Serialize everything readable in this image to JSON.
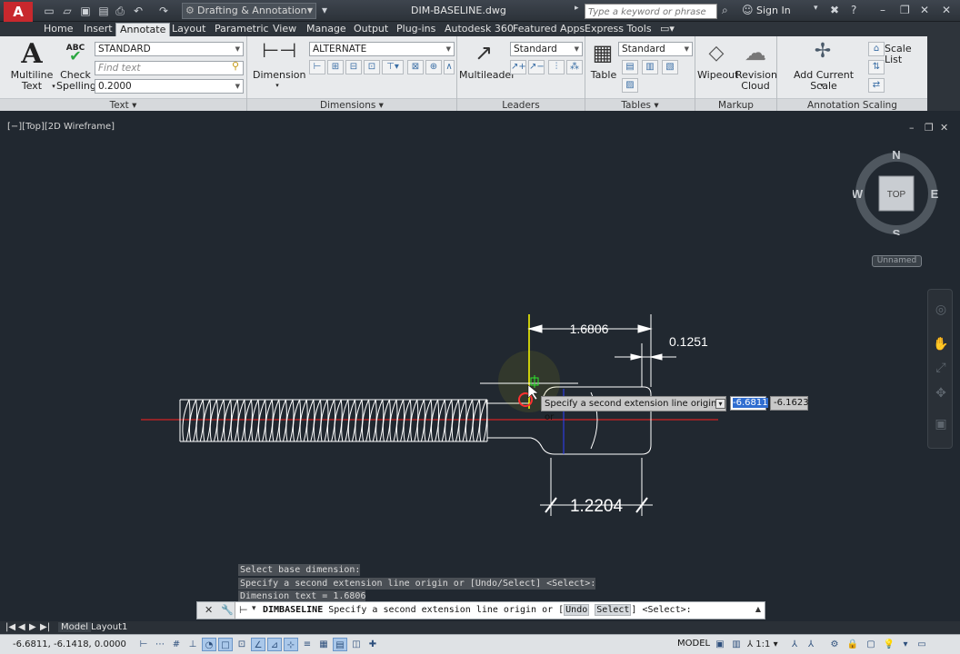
{
  "app": {
    "logo_letter": "A",
    "document_title": "DIM-BASELINE.dwg",
    "workspace": "Drafting & Annotation",
    "search_placeholder": "Type a keyword or phrase",
    "sign_in": "Sign In"
  },
  "ribbon_tabs": [
    "Home",
    "Insert",
    "Annotate",
    "Layout",
    "Parametric",
    "View",
    "Manage",
    "Output",
    "Plug-ins",
    "Autodesk 360",
    "Featured Apps",
    "Express Tools"
  ],
  "active_tab": "Annotate",
  "panels": {
    "text": {
      "title": "Text",
      "multiline_label_1": "Multiline",
      "multiline_label_2": "Text",
      "check_label_1": "Check",
      "check_label_2": "Spelling",
      "check_abc": "ABC",
      "style": "STANDARD",
      "find_placeholder": "Find text",
      "height": "0.2000"
    },
    "dimensions": {
      "title": "Dimensions",
      "dimension_label": "Dimension",
      "style": "ALTERNATE"
    },
    "leaders": {
      "title": "Leaders",
      "multileader_label": "Multileader",
      "style": "Standard"
    },
    "tables": {
      "title": "Tables",
      "table_label": "Table",
      "style": "Standard"
    },
    "markup": {
      "title": "Markup",
      "wipeout_label": "Wipeout",
      "revision_label_1": "Revision",
      "revision_label_2": "Cloud"
    },
    "annotation_scaling": {
      "title": "Annotation Scaling",
      "add_scale_label": "Add Current Scale",
      "scale_list_label": "Scale List"
    }
  },
  "viewport": {
    "label": "[−][Top][2D Wireframe]",
    "viewcube": {
      "north": "N",
      "south": "S",
      "east": "E",
      "west": "W",
      "top": "TOP"
    },
    "ucs_name": "Unnamed"
  },
  "dimensions_on_drawing": {
    "top": "1.6806",
    "small": "0.1251",
    "bottom": "1.2204"
  },
  "dynamic_input": {
    "prompt": "Specify a second extension line origin or",
    "x_value": "-6.6811",
    "y_value": "-6.1623"
  },
  "command_history": [
    "Select base dimension:",
    "Specify a second extension line origin or [Undo/Select] <Select>:",
    "Dimension text = 1.6806"
  ],
  "command_line": {
    "command": "DIMBASELINE",
    "prompt_before": "Specify a second extension line origin or [",
    "option_undo": "Undo",
    "option_select": "Select",
    "prompt_after": "] <Select>:"
  },
  "layout_tabs": [
    "Model",
    "Layout1"
  ],
  "status_bar": {
    "coordinates": "-6.6811, -6.1418, 0.0000",
    "model": "MODEL",
    "scale": "1:1"
  },
  "colors": {
    "canvas": "#212830",
    "dimension_white": "#ffffff",
    "centerline_red": "#ff2020",
    "highlight_yellow": "#ffff00",
    "snap_green": "#2ee82e",
    "ribbon": "#e8eaec"
  }
}
